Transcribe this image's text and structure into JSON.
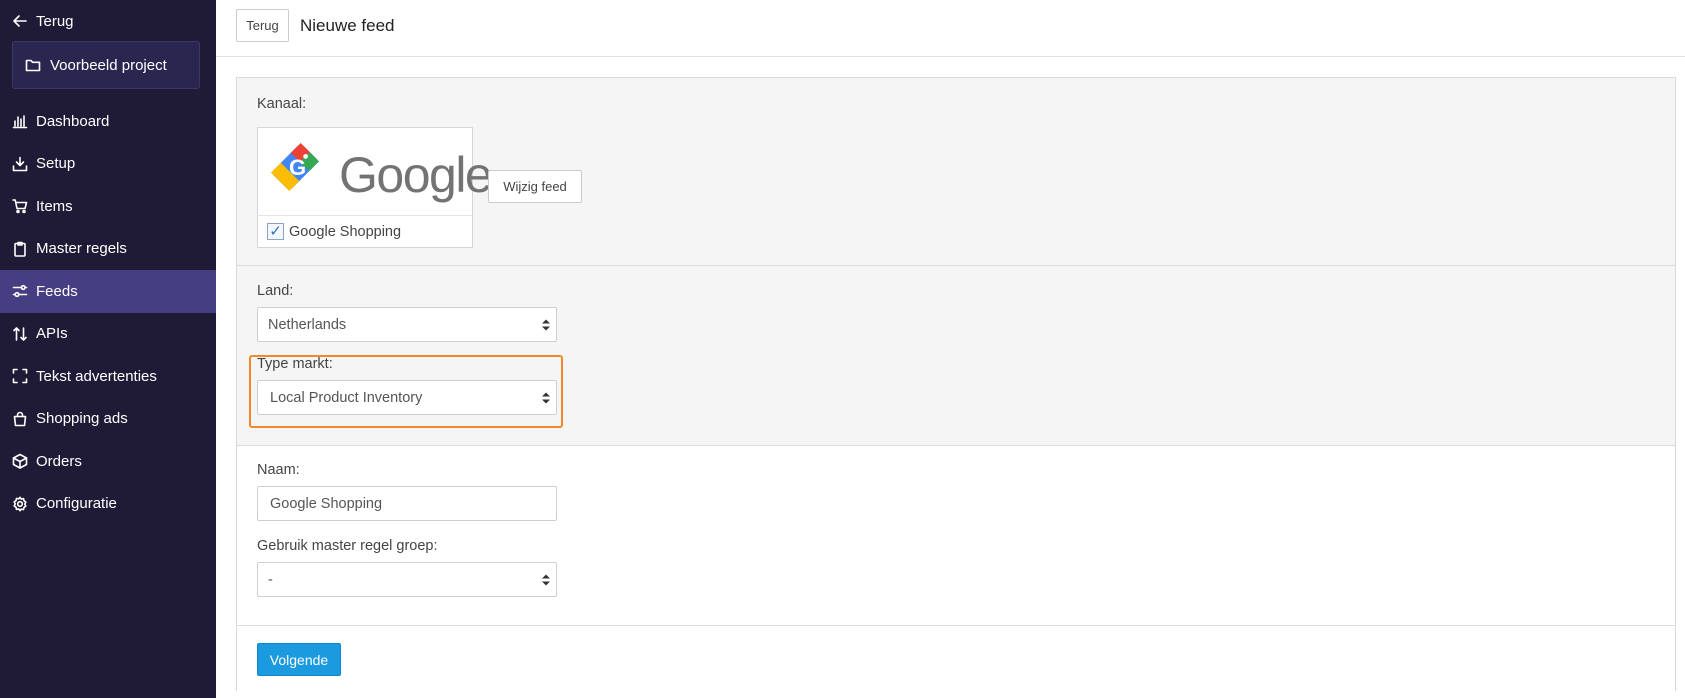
{
  "sidebar": {
    "back_label": "Terug",
    "project_label": "Voorbeeld project",
    "items": [
      {
        "label": "Dashboard",
        "icon": "bar-chart-icon"
      },
      {
        "label": "Setup",
        "icon": "download-icon"
      },
      {
        "label": "Items",
        "icon": "cart-icon"
      },
      {
        "label": "Master regels",
        "icon": "clipboard-icon"
      },
      {
        "label": "Feeds",
        "icon": "sliders-icon",
        "active": true
      },
      {
        "label": "APIs",
        "icon": "sort-arrows-icon"
      },
      {
        "label": "Tekst advertenties",
        "icon": "frame-corners-icon"
      },
      {
        "label": "Shopping ads",
        "icon": "shopping-bag-icon"
      },
      {
        "label": "Orders",
        "icon": "box-icon"
      },
      {
        "label": "Configuratie",
        "icon": "gear-icon"
      }
    ]
  },
  "header": {
    "back_button": "Terug",
    "title": "Nieuwe feed"
  },
  "form": {
    "channel_label": "Kanaal:",
    "channel_logo_text": "Google",
    "channel_name": "Google Shopping",
    "channel_checked": true,
    "change_feed_button": "Wijzig feed",
    "country_label": "Land:",
    "country_value": "Netherlands",
    "market_label": "Type markt:",
    "market_value": "Local Product Inventory",
    "name_label": "Naam:",
    "name_value": "Google Shopping",
    "master_group_label": "Gebruik master regel groep:",
    "master_group_value": "-",
    "next_button": "Volgende"
  },
  "colors": {
    "sidebar_bg": "#1f1b37",
    "active_item_bg": "#463e82",
    "highlight_border": "#f0892a",
    "primary_button": "#1b9ae0"
  }
}
